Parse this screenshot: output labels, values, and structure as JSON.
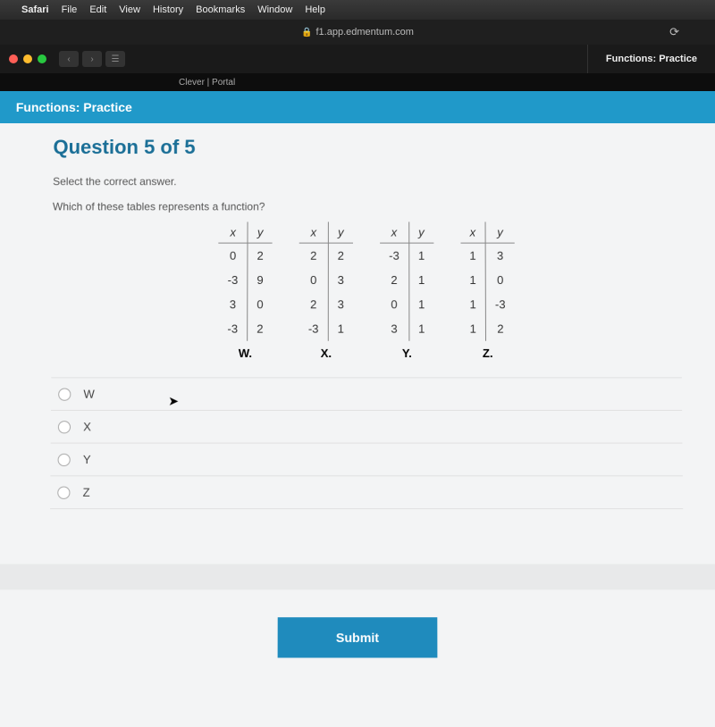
{
  "menubar": {
    "apple": "",
    "items": [
      "Safari",
      "File",
      "Edit",
      "View",
      "History",
      "Bookmarks",
      "Window",
      "Help"
    ]
  },
  "address": {
    "lock": "🔒",
    "url": "f1.app.edmentum.com",
    "refresh": "⟳"
  },
  "tabs": {
    "right_title": "Functions: Practice",
    "sub": "Clever | Portal"
  },
  "bluebar": "Functions: Practice",
  "question": {
    "title": "Question 5 of 5",
    "prompt1": "Select the correct answer.",
    "prompt2": "Which of these tables represents a function?"
  },
  "tables": [
    {
      "label": "W.",
      "head": [
        "x",
        "y"
      ],
      "rows": [
        [
          "0",
          "2"
        ],
        [
          "-3",
          "9"
        ],
        [
          "3",
          "0"
        ],
        [
          "-3",
          "2"
        ]
      ]
    },
    {
      "label": "X.",
      "head": [
        "x",
        "y"
      ],
      "rows": [
        [
          "2",
          "2"
        ],
        [
          "0",
          "3"
        ],
        [
          "2",
          "3"
        ],
        [
          "-3",
          "1"
        ]
      ]
    },
    {
      "label": "Y.",
      "head": [
        "x",
        "y"
      ],
      "rows": [
        [
          "-3",
          "1"
        ],
        [
          "2",
          "1"
        ],
        [
          "0",
          "1"
        ],
        [
          "3",
          "1"
        ]
      ]
    },
    {
      "label": "Z.",
      "head": [
        "x",
        "y"
      ],
      "rows": [
        [
          "1",
          "3"
        ],
        [
          "1",
          "0"
        ],
        [
          "1",
          "-3"
        ],
        [
          "1",
          "2"
        ]
      ]
    }
  ],
  "options": [
    "W",
    "X",
    "Y",
    "Z"
  ],
  "submit": "Submit"
}
